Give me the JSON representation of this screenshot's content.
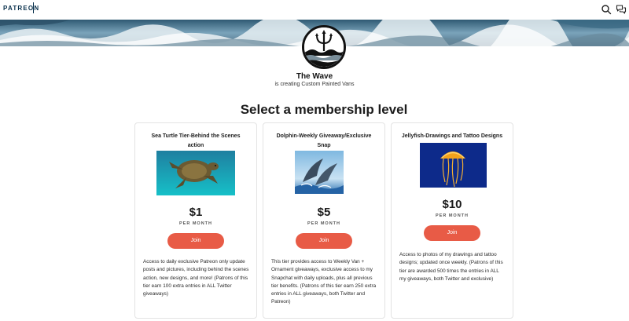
{
  "nav": {
    "logo_text": "PATREON",
    "icons": [
      "search-icon",
      "chat-icon"
    ]
  },
  "creator": {
    "name": "The Wave",
    "tagline": "is creating Custom Painted Vans"
  },
  "section_title": "Select a membership level",
  "tiers": [
    {
      "title": "Sea Turtle Tier-Behind the Scenes action",
      "price": "$1",
      "period": "PER MONTH",
      "join_label": "Join",
      "description": "Access to daily exclusive Patreon only update posts and pictures, including behind the scenes action, new designs, and more! (Patrons of this tier earn 100 extra entries in ALL Twitter giveaways)"
    },
    {
      "title": "Dolphin-Weekly Giveaway/Exclusive Snap",
      "price": "$5",
      "period": "PER MONTH",
      "join_label": "Join",
      "description": "This tier provides access to Weekly Van + Ornament giveaways, exclusive access to my Snapchat with daily uploads, plus all previous tier benefits. (Patrons of this tier earn 250 extra entries in ALL giveaways, both Twitter and Patreon)"
    },
    {
      "title": "Jellyfish-Drawings and Tattoo Designs",
      "price": "$10",
      "period": "PER MONTH",
      "join_label": "Join",
      "description": "Access to photos of my drawings and tattoo designs; updated once weekly. (Patrons of this tier are awarded 500 times the entries in ALL my giveaways, both Twitter and exclusive)"
    }
  ],
  "colors": {
    "accent": "#e85b46",
    "brand_navy": "#052d49",
    "card_border": "#e3e3e3"
  }
}
